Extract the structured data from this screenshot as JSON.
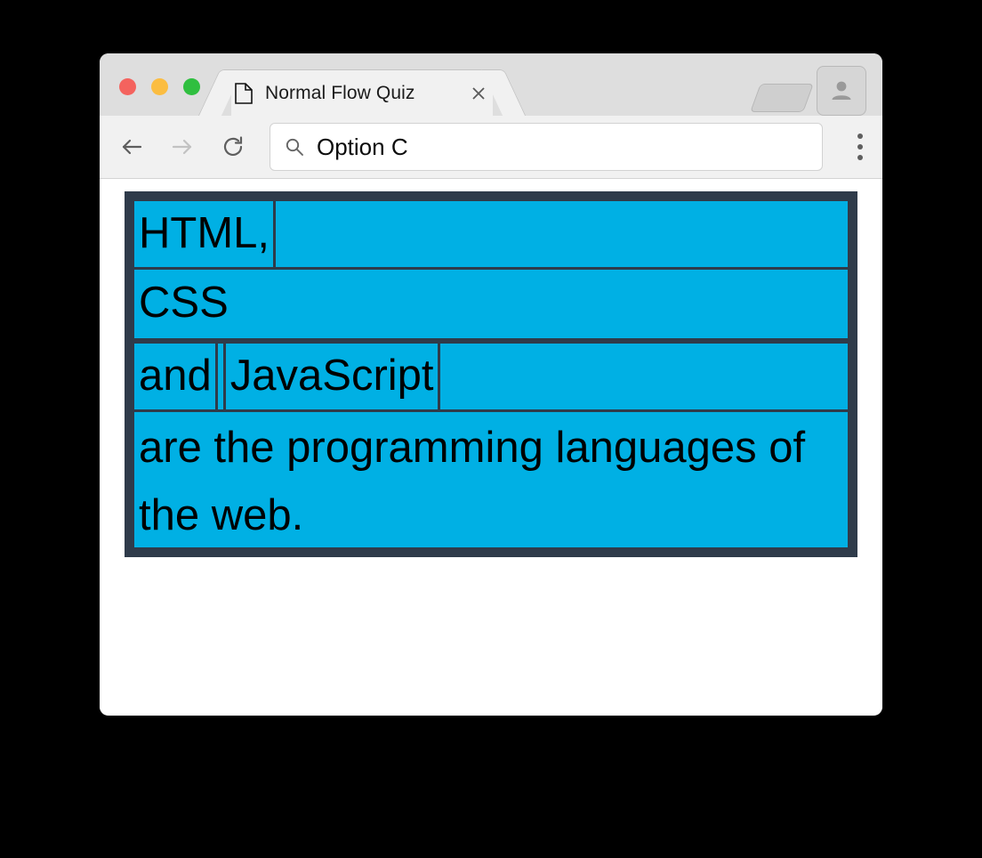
{
  "window": {
    "traffic_lights": [
      {
        "name": "close",
        "color": "#f4635e"
      },
      {
        "name": "minimize",
        "color": "#fbbd41"
      },
      {
        "name": "zoom",
        "color": "#2fbf3f"
      }
    ]
  },
  "tabs": {
    "active": {
      "title": "Normal Flow Quiz",
      "page_icon": "page-icon",
      "close_icon": "close-icon"
    },
    "new_tab_icon": "new-tab-icon"
  },
  "toolbar": {
    "back_icon": "back-arrow-icon",
    "forward_icon": "forward-arrow-icon",
    "reload_icon": "reload-icon",
    "menu_icon": "overflow-menu-icon",
    "profile_icon": "profile-avatar-icon"
  },
  "address": {
    "search_icon": "search-icon",
    "value": "Option C",
    "placeholder": "Search or type URL"
  },
  "page": {
    "title": "Normal Flow Quiz",
    "colors": {
      "box_fill": "#00b0e4",
      "box_border": "#2f3b4a",
      "text": "#000000"
    },
    "blocks": [
      {
        "kind": "inline-spans",
        "spans": [
          "HTML,"
        ]
      },
      {
        "kind": "block",
        "text": "CSS"
      },
      {
        "kind": "inline-spans",
        "spans": [
          "and",
          "JavaScript"
        ]
      },
      {
        "kind": "block",
        "text": "are the programming languages of the web."
      }
    ]
  }
}
